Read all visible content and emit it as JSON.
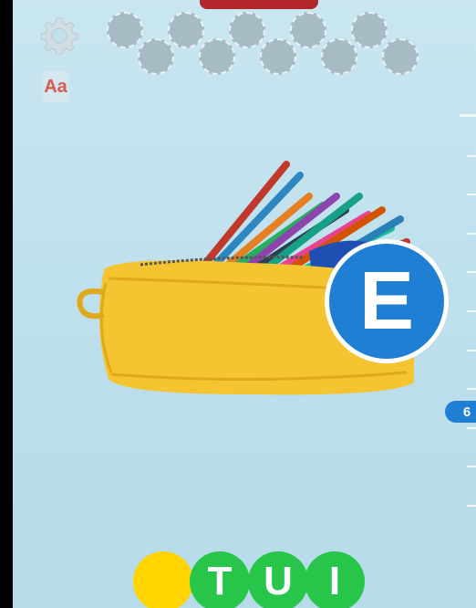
{
  "toolbar": {
    "settings_icon": "gear-icon",
    "font_button_label": "Aa"
  },
  "slots": {
    "count": 10
  },
  "current_letter": "E",
  "level": "6",
  "letter_balls": [
    {
      "letter": "",
      "color": "#ffd400"
    },
    {
      "letter": "T",
      "color": "#27c54a"
    },
    {
      "letter": "U",
      "color": "#27c54a"
    },
    {
      "letter": "I",
      "color": "#27c54a"
    }
  ],
  "colors": {
    "background": "#c3e3ef",
    "accent_blue": "#1e7fd4",
    "green": "#27c54a",
    "yellow": "#ffd400",
    "top_bar": "#b3262a"
  }
}
